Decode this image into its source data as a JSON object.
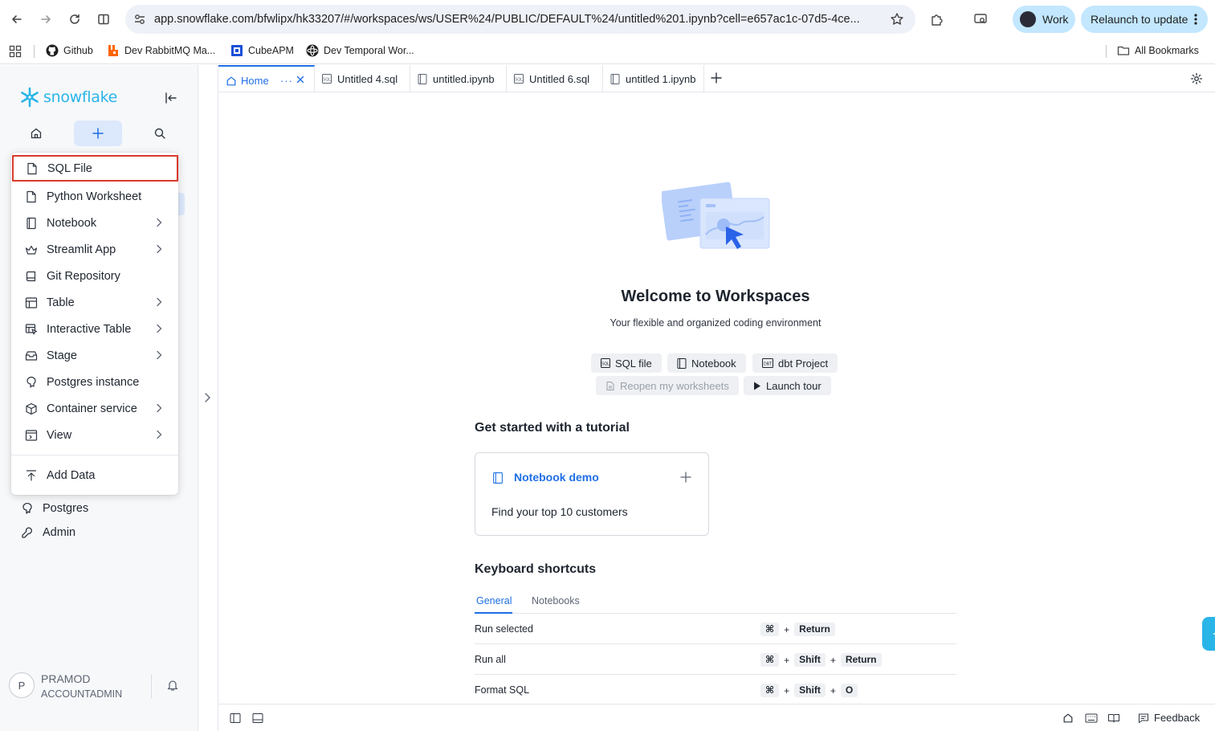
{
  "browser": {
    "url": "app.snowflake.com/bfwlipx/hk33207/#/workspaces/ws/USER%24/PUBLIC/DEFAULT%24/untitled%201.ipynb?cell=e657ac1c-07d5-4ce...",
    "profile_label": "Work",
    "relaunch_label": "Relaunch to update",
    "bookmarks": [
      {
        "label": "Github",
        "icon": "github-icon"
      },
      {
        "label": "Dev RabbitMQ Ma...",
        "icon": "rabbitmq-icon"
      },
      {
        "label": "CubeAPM",
        "icon": "cubeapm-icon"
      },
      {
        "label": "Dev Temporal Wor...",
        "icon": "temporal-icon"
      }
    ],
    "all_bookmarks_label": "All Bookmarks"
  },
  "sidebar": {
    "logo_text": "snowflake",
    "nav_items": [
      {
        "label": "Postgres",
        "icon": "postgres-icon"
      },
      {
        "label": "Admin",
        "icon": "admin-icon"
      }
    ],
    "user": {
      "initial": "P",
      "name": "PRAMOD",
      "role": "ACCOUNTADMIN"
    }
  },
  "create_menu": {
    "items": [
      {
        "label": "SQL File",
        "icon": "file-icon",
        "submenu": false,
        "selected": true
      },
      {
        "label": "Python Worksheet",
        "icon": "file-icon",
        "submenu": false
      },
      {
        "label": "Notebook",
        "icon": "notebook-icon",
        "submenu": true
      },
      {
        "label": "Streamlit App",
        "icon": "streamlit-icon",
        "submenu": true
      },
      {
        "label": "Git Repository",
        "icon": "git-repo-icon",
        "submenu": false
      },
      {
        "label": "Table",
        "icon": "table-icon",
        "submenu": true
      },
      {
        "label": "Interactive Table",
        "icon": "interactive-table-icon",
        "submenu": true
      },
      {
        "label": "Stage",
        "icon": "stage-icon",
        "submenu": true
      },
      {
        "label": "Postgres instance",
        "icon": "postgres-icon",
        "submenu": false
      },
      {
        "label": "Container service",
        "icon": "container-icon",
        "submenu": true
      },
      {
        "label": "View",
        "icon": "view-icon",
        "submenu": true
      }
    ],
    "footer_item": {
      "label": "Add Data",
      "icon": "upload-icon"
    }
  },
  "tabs": [
    {
      "label": "Home",
      "icon": "home-icon",
      "active": true
    },
    {
      "label": "Untitled 4.sql",
      "icon": "sql-file-icon"
    },
    {
      "label": "untitled.ipynb",
      "icon": "notebook-icon"
    },
    {
      "label": "Untitled 6.sql",
      "icon": "sql-file-icon"
    },
    {
      "label": "untitled 1.ipynb",
      "icon": "notebook-icon"
    }
  ],
  "home": {
    "title": "Welcome to Workspaces",
    "subtitle": "Your flexible and organized coding environment",
    "quick_actions": [
      {
        "label": "SQL file",
        "icon": "sql-icon"
      },
      {
        "label": "Notebook",
        "icon": "notebook-icon"
      },
      {
        "label": "dbt Project",
        "icon": "dbt-icon"
      },
      {
        "label": "Reopen my worksheets",
        "icon": "reopen-icon",
        "disabled": true
      },
      {
        "label": "Launch tour",
        "icon": "play-icon"
      }
    ],
    "tutorial_heading": "Get started with a tutorial",
    "tutorial_card": {
      "title": "Notebook demo",
      "description": "Find your top 10 customers"
    },
    "shortcuts_heading": "Keyboard shortcuts",
    "shortcut_tabs": [
      "General",
      "Notebooks"
    ],
    "shortcuts": [
      {
        "label": "Run selected",
        "keys": [
          "⌘",
          "Return"
        ]
      },
      {
        "label": "Run all",
        "keys": [
          "⌘",
          "Shift",
          "Return"
        ]
      },
      {
        "label": "Format SQL",
        "keys": [
          "⌘",
          "Shift",
          "O"
        ]
      }
    ]
  },
  "statusbar": {
    "feedback_label": "Feedback"
  },
  "colors": {
    "accent": "#1f6fe5",
    "brand": "#29b5e8",
    "selection_outline": "#d93a2b"
  }
}
